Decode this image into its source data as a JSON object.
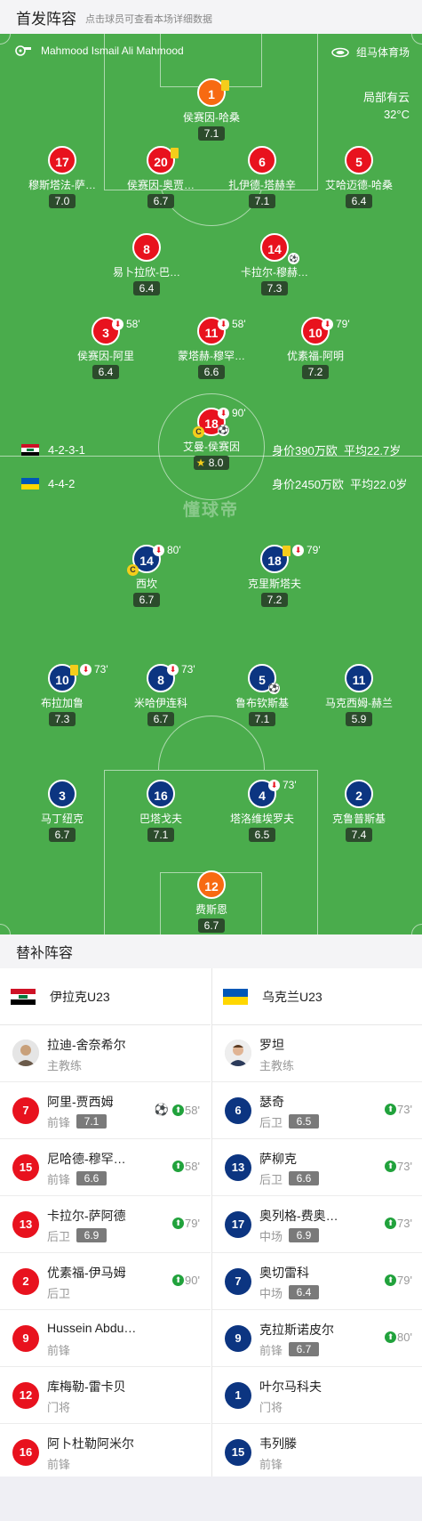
{
  "header": {
    "title": "首发阵容",
    "subtitle": "点击球员可查看本场详细数据"
  },
  "pitch": {
    "referee": "Mahmood Ismail Ali Mahmood",
    "venue": "组马体育场",
    "weather": "局部有云",
    "temperature": "32°C",
    "watermark": "懂球帝"
  },
  "home_team": {
    "formation": "4-2-3-1",
    "value": "身价390万欧",
    "age": "平均22.7岁"
  },
  "away_team": {
    "formation": "4-4-2",
    "value": "身价2450万欧",
    "age": "平均22.0岁"
  },
  "home_players": [
    {
      "num": "1",
      "name": "侯赛因-哈桑",
      "rating": "7.1",
      "color": "orange"
    },
    {
      "num": "17",
      "name": "穆斯塔法-萨…",
      "rating": "7.0",
      "color": "red"
    },
    {
      "num": "20",
      "name": "侯赛因-奥贾…",
      "rating": "6.7",
      "color": "red"
    },
    {
      "num": "6",
      "name": "扎伊德-塔赫辛",
      "rating": "7.1",
      "color": "red"
    },
    {
      "num": "5",
      "name": "艾哈迈德-哈桑",
      "rating": "6.4",
      "color": "red"
    },
    {
      "num": "8",
      "name": "易卜拉欣-巴…",
      "rating": "6.4",
      "color": "red"
    },
    {
      "num": "14",
      "name": "卡拉尔-穆赫…",
      "rating": "7.3",
      "color": "red"
    },
    {
      "num": "3",
      "name": "侯赛因-阿里",
      "rating": "6.4",
      "color": "red",
      "sub": "58'"
    },
    {
      "num": "11",
      "name": "蒙塔赫-穆罕…",
      "rating": "6.6",
      "color": "red",
      "sub": "58'"
    },
    {
      "num": "10",
      "name": "优素福-阿明",
      "rating": "7.2",
      "color": "red",
      "sub": "79'"
    },
    {
      "num": "18",
      "name": "艾曼-侯赛因",
      "rating": "8.0",
      "color": "red",
      "sub": "90'"
    }
  ],
  "away_players": [
    {
      "num": "14",
      "name": "西坎",
      "rating": "6.7",
      "color": "blue",
      "sub": "80'"
    },
    {
      "num": "18",
      "name": "克里斯塔夫",
      "rating": "7.2",
      "color": "blue",
      "sub": "79'"
    },
    {
      "num": "10",
      "name": "布拉加鲁",
      "rating": "7.3",
      "color": "blue",
      "sub": "73'"
    },
    {
      "num": "8",
      "name": "米哈伊连科",
      "rating": "6.7",
      "color": "blue",
      "sub": "73'"
    },
    {
      "num": "5",
      "name": "鲁布钦斯基",
      "rating": "7.1",
      "color": "blue"
    },
    {
      "num": "11",
      "name": "马克西姆-赫兰",
      "rating": "5.9",
      "color": "blue"
    },
    {
      "num": "3",
      "name": "马丁纽克",
      "rating": "6.7",
      "color": "blue"
    },
    {
      "num": "16",
      "name": "巴塔戈夫",
      "rating": "7.1",
      "color": "blue"
    },
    {
      "num": "4",
      "name": "塔洛维埃罗夫",
      "rating": "6.5",
      "color": "blue",
      "sub": "73'"
    },
    {
      "num": "2",
      "name": "克鲁普斯基",
      "rating": "7.4",
      "color": "blue"
    },
    {
      "num": "12",
      "name": "费斯恩",
      "rating": "6.7",
      "color": "orange"
    }
  ],
  "subs": {
    "title": "替补阵容",
    "home": {
      "team": "伊拉克U23",
      "coach": {
        "name": "拉迪-舍奈希尔",
        "role": "主教练"
      },
      "players": [
        {
          "num": "7",
          "name": "阿里-贾西姆",
          "pos": "前锋",
          "rating": "7.1",
          "minute": "58'",
          "goal": true
        },
        {
          "num": "15",
          "name": "尼哈德-穆罕…",
          "pos": "前锋",
          "rating": "6.6",
          "minute": "58'"
        },
        {
          "num": "13",
          "name": "卡拉尔-萨阿德",
          "pos": "后卫",
          "rating": "6.9",
          "minute": "79'"
        },
        {
          "num": "2",
          "name": "优素福-伊马姆",
          "pos": "后卫",
          "rating": "",
          "minute": "90'"
        },
        {
          "num": "9",
          "name": "Hussein Abdu…",
          "pos": "前锋",
          "rating": "",
          "minute": ""
        },
        {
          "num": "12",
          "name": "库梅勒-雷卡贝",
          "pos": "门将",
          "rating": "",
          "minute": ""
        },
        {
          "num": "16",
          "name": "阿卜杜勒阿米尔",
          "pos": "前锋",
          "rating": "",
          "minute": ""
        }
      ]
    },
    "away": {
      "team": "乌克兰U23",
      "coach": {
        "name": "罗坦",
        "role": "主教练"
      },
      "players": [
        {
          "num": "6",
          "name": "瑟奇",
          "pos": "后卫",
          "rating": "6.5",
          "minute": "73'"
        },
        {
          "num": "13",
          "name": "萨柳克",
          "pos": "后卫",
          "rating": "6.6",
          "minute": "73'"
        },
        {
          "num": "17",
          "name": "奥列格-费奥…",
          "pos": "中场",
          "rating": "6.9",
          "minute": "73'"
        },
        {
          "num": "7",
          "name": "奥切雷科",
          "pos": "中场",
          "rating": "6.4",
          "minute": "79'"
        },
        {
          "num": "9",
          "name": "克拉斯诺皮尔",
          "pos": "前锋",
          "rating": "6.7",
          "minute": "80'"
        },
        {
          "num": "1",
          "name": "叶尔马科夫",
          "pos": "门将",
          "rating": "",
          "minute": ""
        },
        {
          "num": "15",
          "name": "韦列滕",
          "pos": "前锋",
          "rating": "",
          "minute": ""
        }
      ]
    }
  },
  "colors": {
    "pitch": "#4aac4c",
    "home": "#e8121e",
    "away": "#0c3581",
    "keeper": "#f76a12",
    "rating_bg": "#2c4b2c"
  }
}
